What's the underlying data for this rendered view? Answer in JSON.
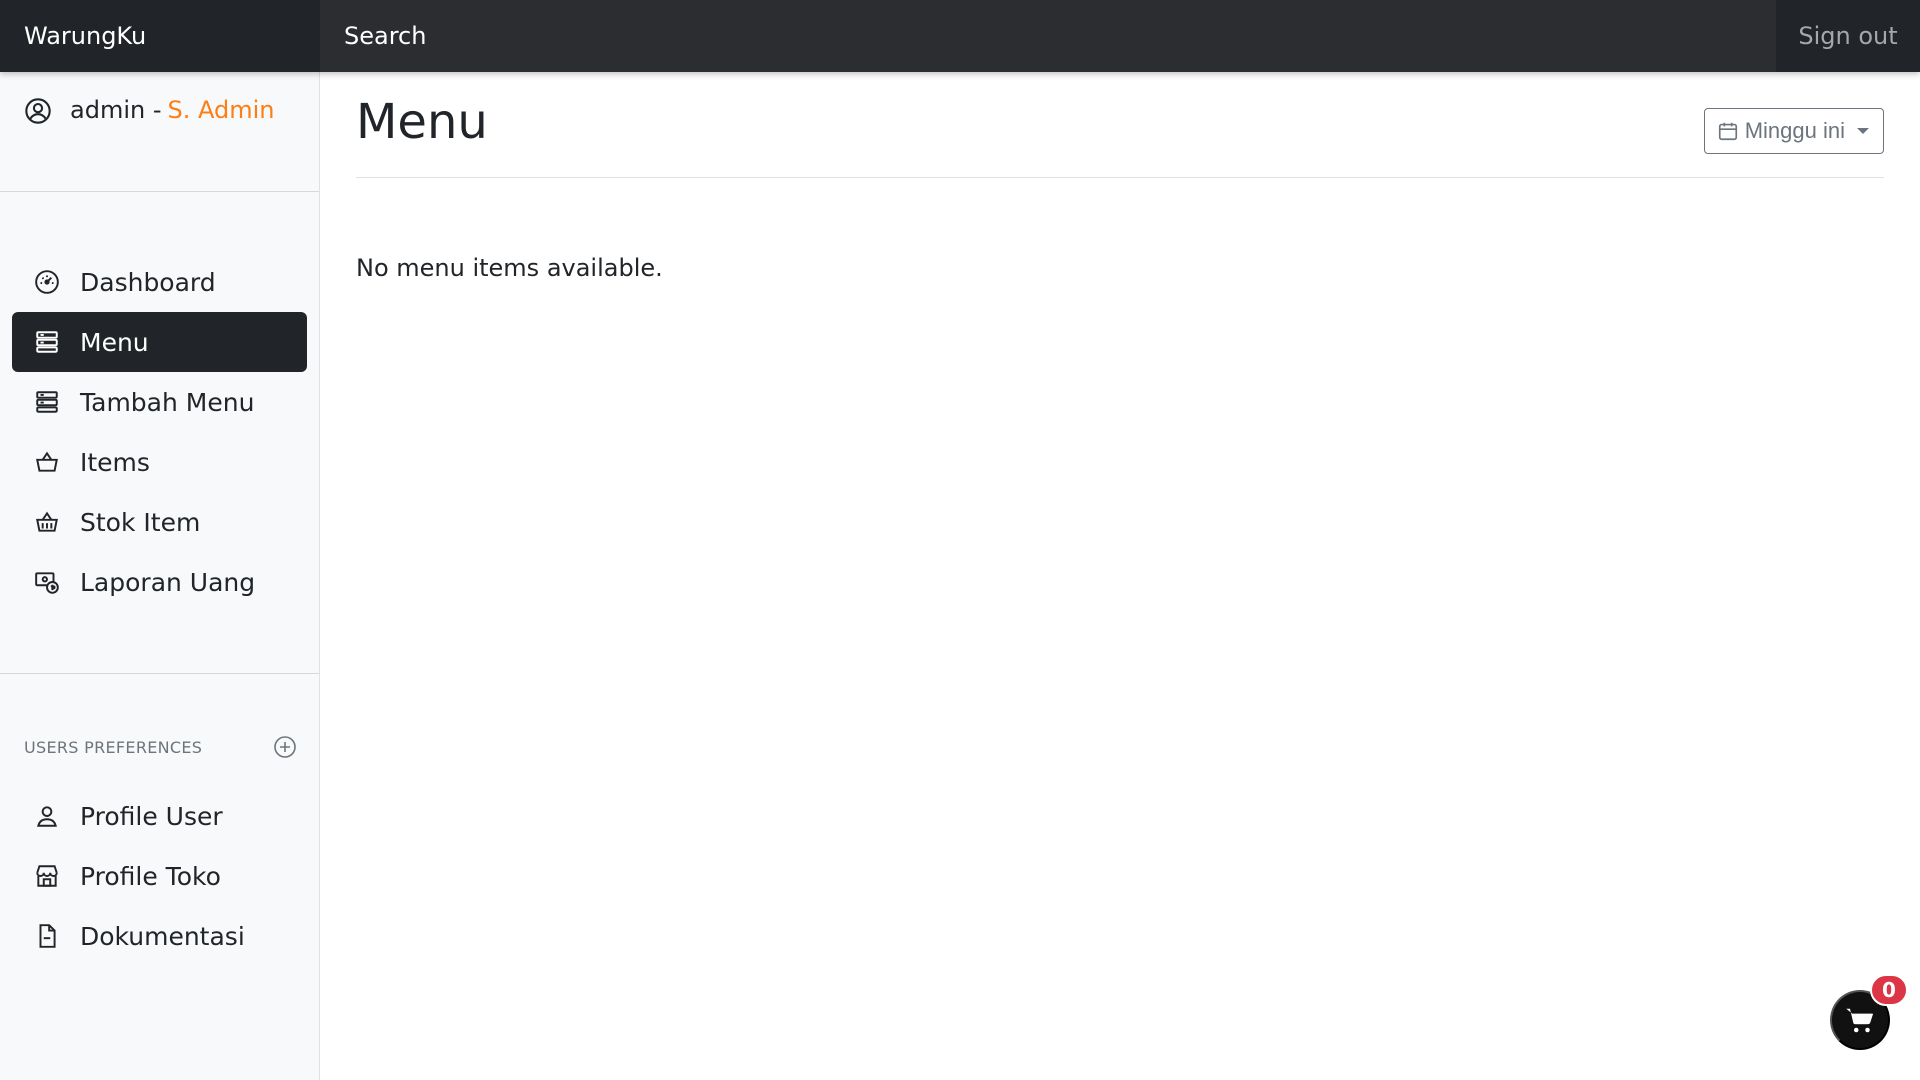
{
  "navbar": {
    "brand": "WarungKu",
    "search_placeholder": "Search",
    "signout_label": "Sign out"
  },
  "sidebar": {
    "user": {
      "name": "admin - ",
      "role": "S. Admin",
      "icon": "user-circle-icon"
    },
    "items": [
      {
        "label": "Dashboard",
        "icon": "speedometer-icon",
        "active": false
      },
      {
        "label": "Menu",
        "icon": "menu-stack-icon",
        "active": true
      },
      {
        "label": "Tambah Menu",
        "icon": "menu-stack-icon",
        "active": false
      },
      {
        "label": "Items",
        "icon": "basket-icon",
        "active": false
      },
      {
        "label": "Stok Item",
        "icon": "basket-stock-icon",
        "active": false
      },
      {
        "label": "Laporan Uang",
        "icon": "cash-report-icon",
        "active": false
      }
    ],
    "prefs_title": "USERS PREFERENCES",
    "prefs_items": [
      {
        "label": "Profile User",
        "icon": "person-icon"
      },
      {
        "label": "Profile Toko",
        "icon": "shop-icon"
      },
      {
        "label": "Dokumentasi",
        "icon": "file-icon"
      }
    ]
  },
  "main": {
    "title": "Menu",
    "period_label": "Minggu ini",
    "empty_message": "No menu items available."
  },
  "cart": {
    "count": "0"
  },
  "colors": {
    "navbar": "#2b2d31",
    "brand_bg": "#212428",
    "accent_orange": "#fd7e14",
    "active_item": "#212529",
    "badge": "#dc3545"
  }
}
